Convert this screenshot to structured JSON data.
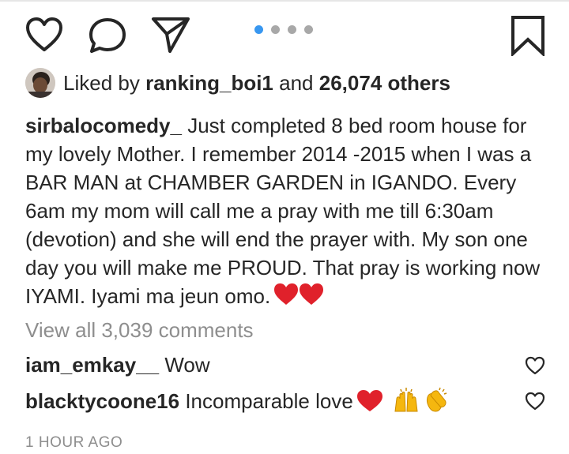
{
  "post": {
    "carousel": {
      "count": 4,
      "active_index": 0,
      "active_color": "#3897f0",
      "inactive_color": "#a8a8a8"
    },
    "actions": {
      "like_icon": "heart-outline-icon",
      "comment_icon": "comment-bubble-icon",
      "share_icon": "paper-plane-icon",
      "save_icon": "bookmark-outline-icon"
    },
    "likes": {
      "prefix": "Liked by",
      "user": "ranking_boi1",
      "and": "and",
      "others": "26,074 others"
    },
    "caption": {
      "username": "sirbalocomedy_",
      "text": " Just completed 8 bed room house for my lovely Mother. I remember 2014 -2015 when I was a BAR MAN at CHAMBER GARDEN in IGANDO. Every 6am my mom will call me a pray with me till 6:30am (devotion) and she will end the prayer with. My son one day you will make me PROUD. That pray is working now IYAMI. Iyami ma jeun omo.",
      "emoji": "red-heart-icon x2"
    },
    "view_all": "View all 3,039 comments",
    "comments": [
      {
        "username": "iam_emkay__",
        "text": " Wow"
      },
      {
        "username": "blacktycoone16",
        "text": " Incomparable love",
        "emoji": "red-heart raising-hands clapping-hands"
      }
    ],
    "timestamp": "1 HOUR AGO",
    "colors": {
      "text": "#262626",
      "muted": "#8e8e8e",
      "heart": "#ed4956",
      "emoji_yellow": "#f5b70f"
    }
  }
}
